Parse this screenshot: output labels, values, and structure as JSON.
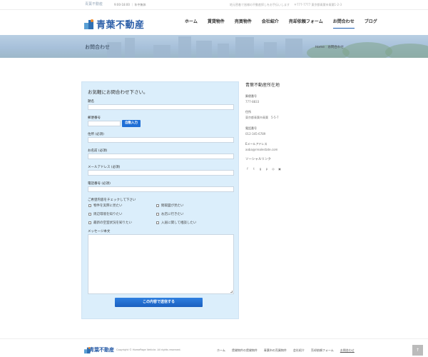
{
  "topbar": {
    "mini_logo": "青葉不動産",
    "hours": "9:00-18:00 ｜ 年中無休",
    "tagline": "地元密着で皆様の不動産探しをお手伝いします",
    "address": "〒777-7777 東京都青葉市青葉1-2-3"
  },
  "header": {
    "logo_text": "青葉不動産",
    "nav": [
      {
        "label": "ホーム"
      },
      {
        "label": "賃貸物件"
      },
      {
        "label": "売買物件"
      },
      {
        "label": "会社紹介"
      },
      {
        "label": "売却依頼フォーム"
      },
      {
        "label": "お問合わせ"
      },
      {
        "label": "ブログ"
      }
    ]
  },
  "hero": {
    "title": "お問合わせ",
    "breadcrumb_home": "Home",
    "breadcrumb_current": "お問合わせ"
  },
  "form": {
    "heading": "お気軽にお問合わせ下さい。",
    "name_label": "題名",
    "zip_label": "郵便番号",
    "autofill_label": "自動入力",
    "address_label": "住所 (必須)",
    "fullname_label": "お名前 (必須)",
    "email_label": "メールアドレス (必須)",
    "phone_label": "電話番号 (必須)",
    "checklist_label": "ご希望内容をチェックして下さい",
    "checks": [
      {
        "label": "物件を実際に見たい"
      },
      {
        "label": "間取図が見たい"
      },
      {
        "label": "周辺環境を知りたい"
      },
      {
        "label": "お店に行きたい"
      },
      {
        "label": "最新の空室状況を知りたい"
      },
      {
        "label": "入居に関して相談したい"
      }
    ],
    "message_label": "メッセージ本文",
    "submit_label": "この内容で送信する"
  },
  "sidebar": {
    "title": "青葉不動産所在地",
    "zip_label": "郵便番号",
    "zip_value": "777-8833",
    "address_label": "住所",
    "address_value": "東京都青葉市青葉　5-5-7",
    "phone_label": "電話番号",
    "phone_value": "012-345-6789",
    "email_label": "Eメールアドレス",
    "email_value": "aoba@rrealestate.com",
    "social_label": "ソーシャルリンク",
    "social_icons": [
      "facebook-icon",
      "twitter-icon",
      "google-plus-icon",
      "pinterest-icon",
      "instagram-icon",
      "rss-icon"
    ]
  },
  "footer": {
    "logo_text": "青葉不動産",
    "copyright": "Copyright © HomePage Vehicle. All rights reserved.",
    "nav": [
      {
        "label": "ホーム"
      },
      {
        "label": "賃貸物件の賃貸物件"
      },
      {
        "label": "青葉市の売買物件"
      },
      {
        "label": "会社紹介"
      },
      {
        "label": "売却依頼フォーム"
      },
      {
        "label": "お問合わせ"
      }
    ],
    "totop": "↑"
  }
}
